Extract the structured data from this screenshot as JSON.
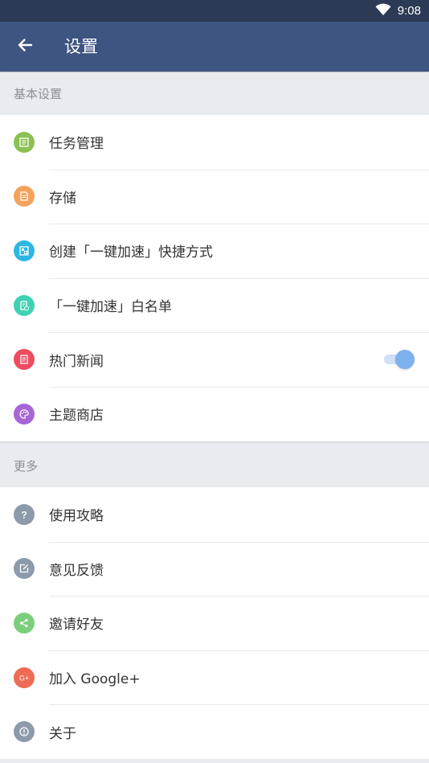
{
  "status_bar": {
    "time": "9:08",
    "wifi_icon": "wifi-icon"
  },
  "app_bar": {
    "back_icon": "arrow-left-icon",
    "title": "设置"
  },
  "sections": [
    {
      "header": "基本设置",
      "items": [
        {
          "label": "任务管理",
          "icon": "task-list-icon",
          "color": "#8cc152"
        },
        {
          "label": "存储",
          "icon": "storage-icon",
          "color": "#f5a25d"
        },
        {
          "label": "创建「一键加速」快捷方式",
          "icon": "shortcut-icon",
          "color": "#2db7e4"
        },
        {
          "label": "「一键加速」白名单",
          "icon": "whitelist-icon",
          "color": "#3fd2b3"
        },
        {
          "label": "热门新闻",
          "icon": "news-icon",
          "color": "#ee4b5f",
          "toggle_on": true
        },
        {
          "label": "主题商店",
          "icon": "palette-icon",
          "color": "#a766d6"
        }
      ]
    },
    {
      "header": "更多",
      "items": [
        {
          "label": "使用攻略",
          "icon": "help-icon",
          "color": "#8c9aaa"
        },
        {
          "label": "意见反馈",
          "icon": "feedback-icon",
          "color": "#8c9aaa"
        },
        {
          "label": "邀请好友",
          "icon": "share-icon",
          "color": "#7bcf7c"
        },
        {
          "label": "加入 Google+",
          "icon": "google-plus-icon",
          "color": "#ee6b55"
        },
        {
          "label": "关于",
          "icon": "info-icon",
          "color": "#8c9aaa"
        }
      ]
    }
  ]
}
